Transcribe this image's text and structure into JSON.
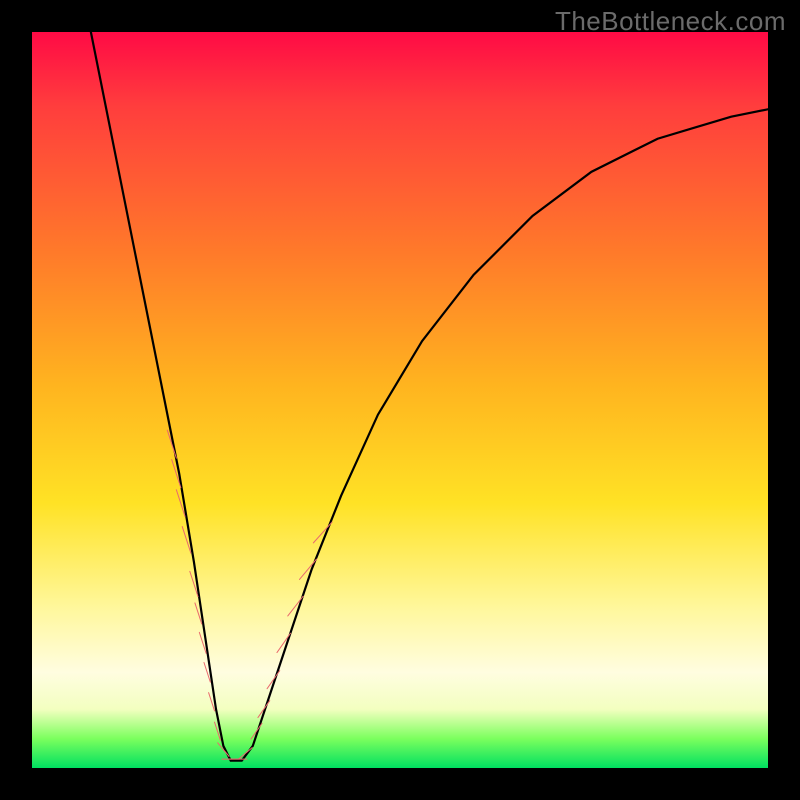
{
  "watermark": {
    "text": "TheBottleneck.com"
  },
  "chart_data": {
    "type": "line",
    "title": "",
    "xlabel": "",
    "ylabel": "",
    "xlim": [
      0,
      100
    ],
    "ylim": [
      0,
      100
    ],
    "grid": false,
    "legend": false,
    "series": [
      {
        "name": "bottleneck-curve",
        "comment": "V-shaped curve. x is horizontal position (0..100 of plot width), y is percentage height (0=bottom, 100=top). Left arm descends steeply; right arm rises and flattens.",
        "x": [
          8,
          10,
          12,
          14,
          16,
          18,
          20,
          22,
          23.5,
          25,
          26,
          27,
          28.5,
          30,
          32,
          35,
          38,
          42,
          47,
          53,
          60,
          68,
          76,
          85,
          95,
          100
        ],
        "y": [
          100,
          90,
          80,
          70,
          60,
          50,
          40,
          28,
          18,
          8,
          3,
          1,
          1,
          3,
          9,
          18,
          27,
          37,
          48,
          58,
          67,
          75,
          81,
          85.5,
          88.5,
          89.5
        ]
      }
    ],
    "markers": {
      "name": "highlight-dots",
      "color": "#ea6a6d",
      "comment": "Pink lozenge markers clustered on both arms in the lower ~30% of the plot, near and around the minimum. Approximate positions on the same x/y scale as the curve.",
      "points": [
        {
          "x": 19.0,
          "y": 44,
          "len": 4.0,
          "angle": -72
        },
        {
          "x": 19.6,
          "y": 40,
          "len": 4.0,
          "angle": -72
        },
        {
          "x": 20.2,
          "y": 36,
          "len": 3.8,
          "angle": -72
        },
        {
          "x": 21.0,
          "y": 31,
          "len": 3.8,
          "angle": -72
        },
        {
          "x": 22.0,
          "y": 25,
          "len": 3.6,
          "angle": -72
        },
        {
          "x": 22.6,
          "y": 21,
          "len": 3.0,
          "angle": -72
        },
        {
          "x": 23.2,
          "y": 17,
          "len": 3.0,
          "angle": -72
        },
        {
          "x": 23.8,
          "y": 13,
          "len": 2.8,
          "angle": -72
        },
        {
          "x": 24.4,
          "y": 9,
          "len": 2.6,
          "angle": -72
        },
        {
          "x": 25.2,
          "y": 5,
          "len": 2.6,
          "angle": -72
        },
        {
          "x": 26.0,
          "y": 2.5,
          "len": 2.4,
          "angle": -50
        },
        {
          "x": 27.0,
          "y": 1.2,
          "len": 2.4,
          "angle": 0
        },
        {
          "x": 28.0,
          "y": 1.2,
          "len": 2.4,
          "angle": 0
        },
        {
          "x": 29.0,
          "y": 2.0,
          "len": 2.4,
          "angle": 40
        },
        {
          "x": 30.5,
          "y": 5.0,
          "len": 2.6,
          "angle": 55
        },
        {
          "x": 31.5,
          "y": 8.0,
          "len": 2.8,
          "angle": 55
        },
        {
          "x": 32.8,
          "y": 12.0,
          "len": 3.0,
          "angle": 55
        },
        {
          "x": 34.2,
          "y": 17.0,
          "len": 3.2,
          "angle": 55
        },
        {
          "x": 35.8,
          "y": 22.0,
          "len": 3.4,
          "angle": 52
        },
        {
          "x": 37.5,
          "y": 27.0,
          "len": 3.6,
          "angle": 50
        },
        {
          "x": 39.5,
          "y": 32.0,
          "len": 3.8,
          "angle": 48
        }
      ]
    },
    "background_gradient_stops": [
      {
        "pos": 0,
        "color": "#ff0a45"
      },
      {
        "pos": 30,
        "color": "#ff7a2a"
      },
      {
        "pos": 64,
        "color": "#ffe225"
      },
      {
        "pos": 87,
        "color": "#fffde0"
      },
      {
        "pos": 100,
        "color": "#00e060"
      }
    ]
  }
}
